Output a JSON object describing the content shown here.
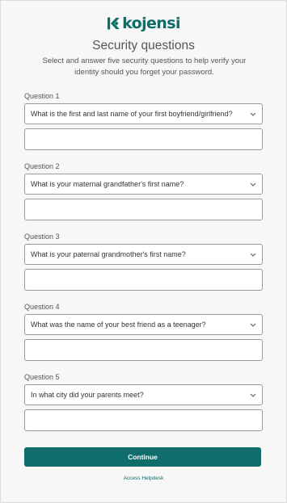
{
  "brand": {
    "name": "kojensi",
    "color": "#0b6e69"
  },
  "page": {
    "title": "Security questions",
    "intro": "Select and answer five security questions to help verify your identity should you forget your password."
  },
  "questions": [
    {
      "label": "Question 1",
      "selected": "What is the first and last name of your first boyfriend/girlfriend?",
      "answer": ""
    },
    {
      "label": "Question 2",
      "selected": "What is your maternal grandfather's first name?",
      "answer": ""
    },
    {
      "label": "Question 3",
      "selected": "What is your paternal grandmother's first name?",
      "answer": ""
    },
    {
      "label": "Question 4",
      "selected": "What was the name of your best friend as a teenager?",
      "answer": ""
    },
    {
      "label": "Question 5",
      "selected": "In what city did your parents meet?",
      "answer": ""
    }
  ],
  "icons": {
    "dropdown": "chevron-down-icon",
    "logo": "kojensi-logo-icon"
  },
  "actions": {
    "continue_label": "Continue",
    "helpdesk_label": "Access Helpdesk",
    "button_color": "#0f6e6c"
  }
}
